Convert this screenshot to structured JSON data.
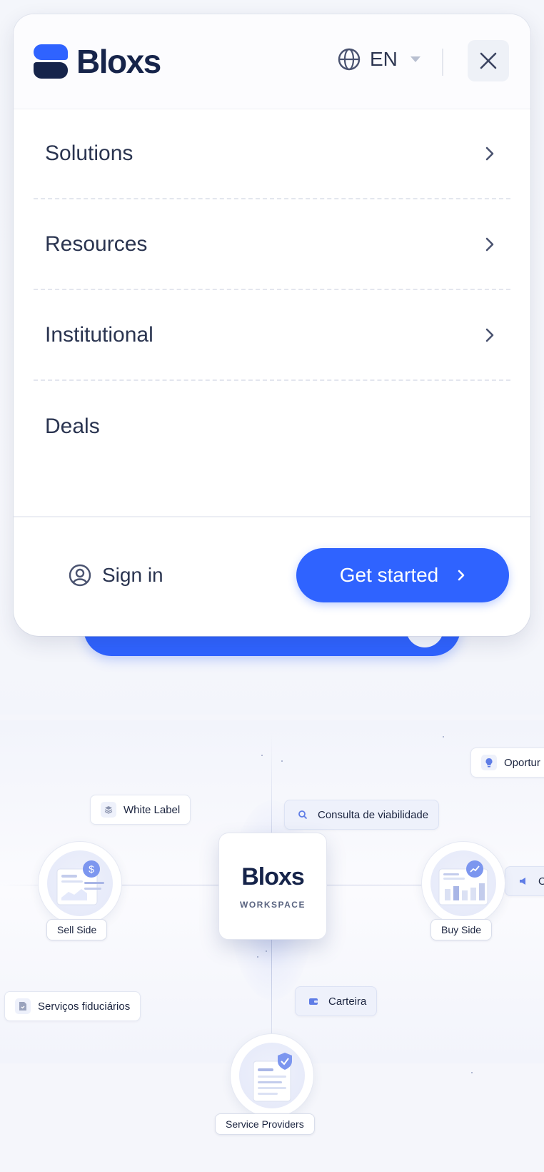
{
  "header": {
    "logo_text": "Bloxs",
    "language": "EN"
  },
  "nav": {
    "items": [
      {
        "label": "Solutions",
        "has_submenu": true
      },
      {
        "label": "Resources",
        "has_submenu": true
      },
      {
        "label": "Institutional",
        "has_submenu": true
      },
      {
        "label": "Deals",
        "has_submenu": false
      }
    ]
  },
  "footer": {
    "sign_in_label": "Sign in",
    "get_started_label": "Get started"
  },
  "diagram": {
    "center_logo": "Bloxs",
    "center_subtitle": "WORKSPACE",
    "nodes": {
      "sell_side": "Sell Side",
      "buy_side": "Buy Side",
      "service_providers": "Service Providers"
    },
    "chips": {
      "oportunidades": "Oportur",
      "white_label": "White Label",
      "consulta": "Consulta de viabilidade",
      "ofertas": "Ofe",
      "servicos": "Serviços fiduciários",
      "carteira": "Carteira"
    }
  },
  "colors": {
    "accent": "#2f63ff",
    "brand_dark": "#16244a",
    "text": "#2a3450",
    "divider": "#e3e6ee"
  },
  "icons": [
    "globe-icon",
    "chevron-down-icon",
    "close-icon",
    "chevron-right-icon",
    "user-circle-icon",
    "layers-icon",
    "search-icon",
    "lightbulb-icon",
    "wallet-icon",
    "document-icon",
    "megaphone-icon",
    "dollar-icon",
    "shield-check-icon"
  ]
}
